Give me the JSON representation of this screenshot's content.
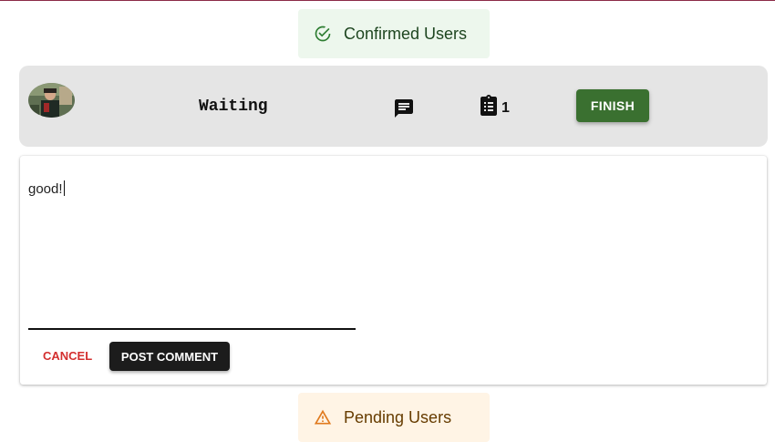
{
  "confirmed_alert": {
    "label": "Confirmed Users",
    "icon": "check-circle-icon",
    "color": "#1e4620"
  },
  "user_row": {
    "avatar": "user-avatar-photo",
    "status": "Waiting",
    "comment_icon": "comment-icon",
    "task_icon": "clipboard-list-icon",
    "task_count": "1",
    "finish_label": "FINISH",
    "finish_color": "#3a7030"
  },
  "comment_form": {
    "text": "good!",
    "cancel_label": "CANCEL",
    "cancel_color": "#d32f2f",
    "post_label": "POST COMMENT"
  },
  "pending_alert": {
    "label": "Pending Users",
    "icon": "warning-triangle-icon",
    "color": "#e07a1f"
  }
}
